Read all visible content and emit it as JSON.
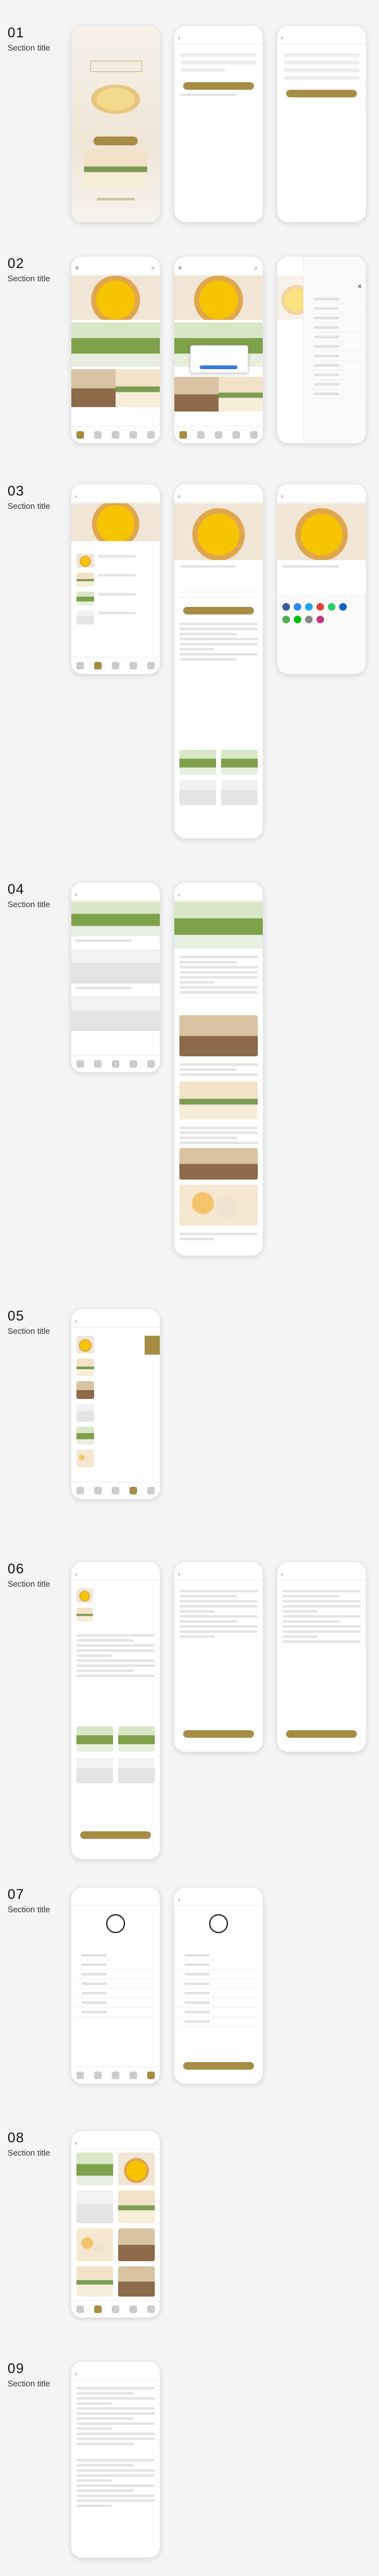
{
  "sections": [
    {
      "num": "01",
      "title": "Section title"
    },
    {
      "num": "02",
      "title": "Section title"
    },
    {
      "num": "03",
      "title": "Section title"
    },
    {
      "num": "04",
      "title": "Section title"
    },
    {
      "num": "05",
      "title": "Section title"
    },
    {
      "num": "06",
      "title": "Section title"
    },
    {
      "num": "07",
      "title": "Section title"
    },
    {
      "num": "08",
      "title": "Section title"
    },
    {
      "num": "09",
      "title": "Section title"
    }
  ],
  "colors": {
    "accent": "#a68c45",
    "price": "#cc3333",
    "background": "#f4f4f4"
  },
  "icons": {
    "back": "back-arrow-icon",
    "menu": "hamburger-menu-icon",
    "search": "search-icon",
    "close": "close-icon",
    "share": "share-icon"
  }
}
